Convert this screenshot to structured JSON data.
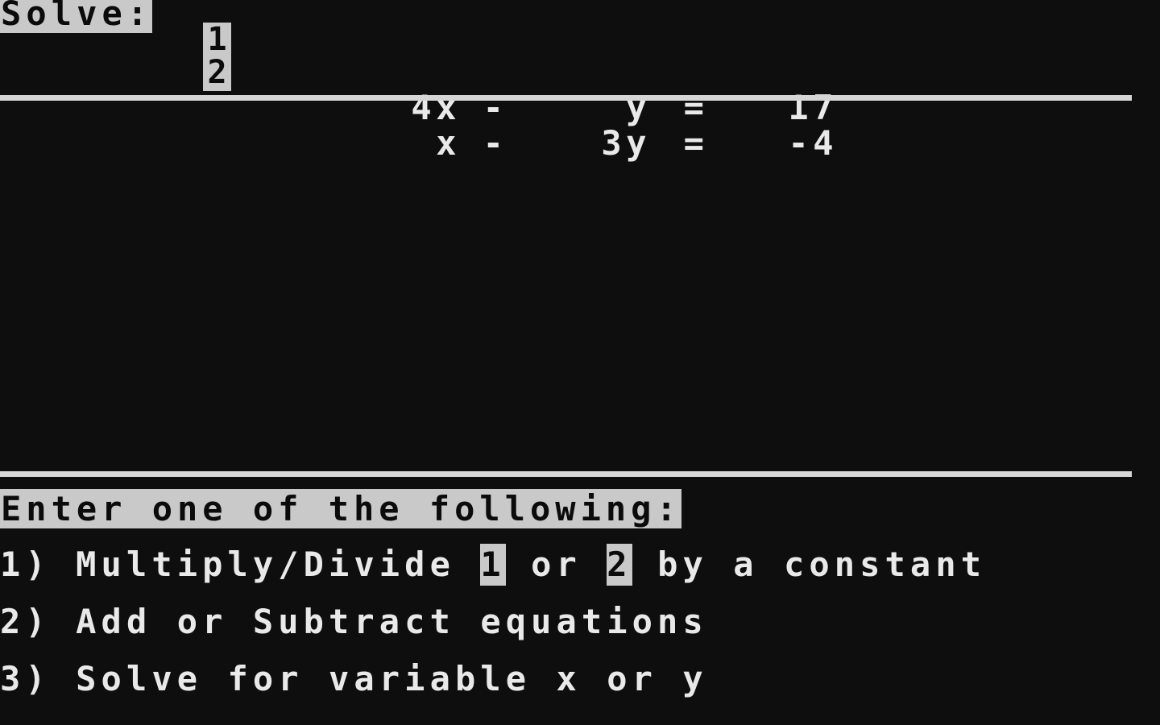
{
  "screen": {
    "background_color": "#0e0e0e",
    "foreground_color": "#e9e9e9",
    "inverse_background_color": "#c9c9c9",
    "inverse_foreground_color": "#0b0b0b"
  },
  "header": {
    "solve_label": "Solve:",
    "equation_numbers": [
      "1",
      "2"
    ]
  },
  "equations": [
    {
      "number": "1",
      "coefficient_x": "4x",
      "operator": "-",
      "term_y": "y",
      "equals": "=",
      "rhs": "17",
      "text": "4x - y = 17"
    },
    {
      "number": "2",
      "coefficient_x": "x",
      "operator": "-",
      "term_y": "3y",
      "equals": "=",
      "rhs": "-4",
      "text": "x - 3y = -4"
    }
  ],
  "prompt": {
    "text": "Enter one of the following:"
  },
  "menu": {
    "items": [
      {
        "key": "1)",
        "part_a": " Multiply/Divide ",
        "ref_1": "1",
        "part_b": " or ",
        "ref_2": "2",
        "part_c": " by a constant"
      },
      {
        "key": "2)",
        "label": " Add or Subtract equations"
      },
      {
        "key": "3)",
        "label": " Solve for variable x or y"
      }
    ]
  }
}
